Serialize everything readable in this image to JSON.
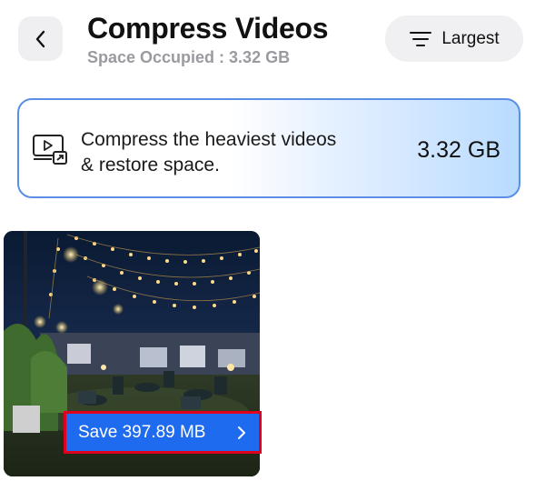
{
  "header": {
    "title": "Compress Videos",
    "subtitle": "Space Occupied : 3.32 GB",
    "back_icon": "chevron-left-icon",
    "sort": {
      "label": "Largest",
      "icon": "sort-lines-icon"
    }
  },
  "banner": {
    "icon": "video-compress-icon",
    "text": "Compress the heaviest videos & restore space.",
    "size": "3.32 GB",
    "border_color": "#5b8fe6"
  },
  "videos": [
    {
      "thumbnail": "outdoor-night-venue-with-string-lights",
      "save_label": "Save 397.89 MB",
      "action_icon": "chevron-right-icon"
    }
  ],
  "colors": {
    "accent": "#1f6bf0",
    "highlight_outline": "#e0001b",
    "secondary_text": "#9a9aa0"
  }
}
